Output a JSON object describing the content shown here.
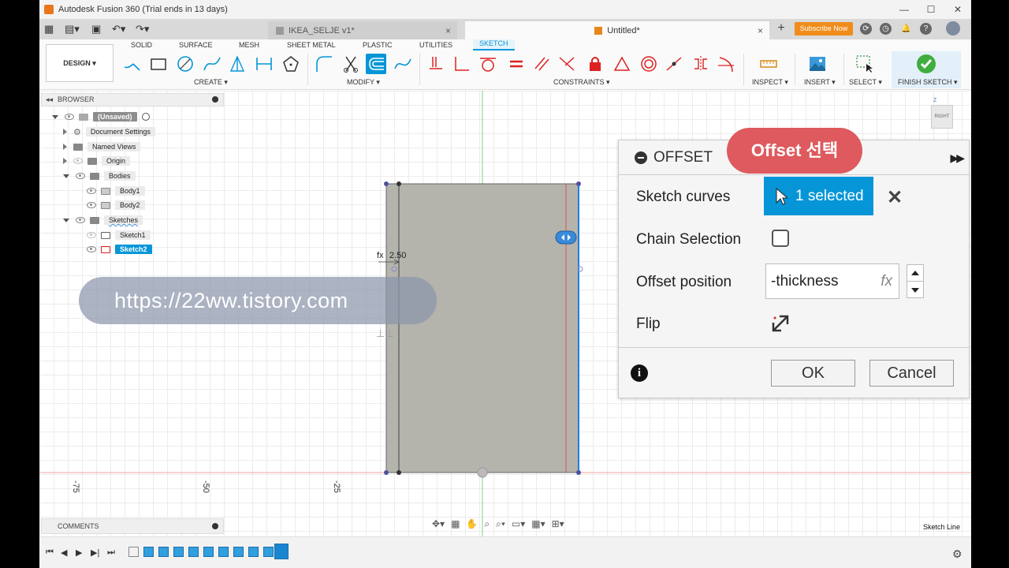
{
  "window": {
    "title": "Autodesk Fusion 360 (Trial ends in 13 days)",
    "controls": [
      "—",
      "☐",
      "✕"
    ]
  },
  "tabs": {
    "inactive_doc": "IKEA_SELJE v1*",
    "active_doc": "Untitled*",
    "close_glyph": "×",
    "new_tab_glyph": "+",
    "subscribe_label": "Subscribe Now"
  },
  "ribbon": {
    "tabs": [
      "SOLID",
      "SURFACE",
      "MESH",
      "SHEET METAL",
      "PLASTIC",
      "UTILITIES",
      "SKETCH"
    ],
    "active_tab": "SKETCH",
    "workspace": "DESIGN ▾",
    "groups": {
      "create": "CREATE ▾",
      "modify": "MODIFY ▾",
      "constraints": "CONSTRAINTS ▾",
      "inspect": "INSPECT ▾",
      "insert": "INSERT ▾",
      "select": "SELECT ▾",
      "finish": "FINISH SKETCH ▾"
    }
  },
  "browser": {
    "title": "BROWSER",
    "items": [
      {
        "label": "(Unsaved)",
        "level": 0
      },
      {
        "label": "Document Settings",
        "level": 1
      },
      {
        "label": "Named Views",
        "level": 1
      },
      {
        "label": "Origin",
        "level": 1
      },
      {
        "label": "Bodies",
        "level": 1
      },
      {
        "label": "Body1",
        "level": 2
      },
      {
        "label": "Body2",
        "level": 2
      },
      {
        "label": "Sketches",
        "level": 1
      },
      {
        "label": "Sketch1",
        "level": 2
      },
      {
        "label": "Sketch2",
        "level": 2
      }
    ]
  },
  "canvas": {
    "dimension_label": "2.50",
    "fx_label": "fx",
    "ruler": [
      "-75",
      "-50",
      "-25"
    ],
    "viewcube_label": "RIGHT",
    "axis_label": "Z"
  },
  "watermark": "https://22ww.tistory.com",
  "callout": "Offset 선택",
  "offset_dialog": {
    "title": "OFFSET",
    "sketch_curves_label": "Sketch curves",
    "selection_text": "1 selected",
    "chain_selection_label": "Chain Selection",
    "offset_position_label": "Offset position",
    "offset_position_value": "-thickness",
    "fx_hint": "fx",
    "flip_label": "Flip",
    "ok_label": "OK",
    "cancel_label": "Cancel",
    "info_glyph": "i"
  },
  "bottom": {
    "comments_title": "COMMENTS",
    "status": "Sketch Line"
  },
  "colors": {
    "accent": "#0696d7",
    "callout": "#de5a5e",
    "subscribe": "#f08c1a",
    "body_fill": "#b4b4ad"
  }
}
